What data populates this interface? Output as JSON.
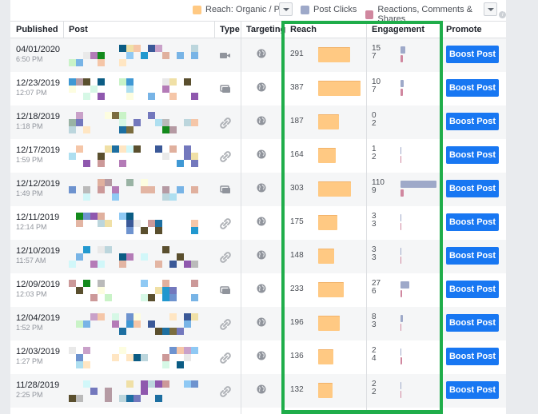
{
  "legend": {
    "items": [
      {
        "label": "Reach: Organic / Paid",
        "color": "#ffc983"
      },
      {
        "label": "Post Clicks",
        "color": "#9ea9c9"
      },
      {
        "label": "Reactions, Comments & Shares",
        "color": "#d0879f"
      }
    ],
    "info_icon": "info-icon"
  },
  "table": {
    "headers": [
      "Published",
      "Post",
      "Type",
      "Targeting",
      "Reach",
      "Engagement",
      "Promote"
    ],
    "reach_max": 387,
    "clicks_max": 110,
    "rows": [
      {
        "date": "04/01/2020",
        "time": "6:50 PM",
        "type": "video",
        "targeting": "public",
        "reach": 291,
        "clicks": 15,
        "reactions": 7,
        "button": "Boost Post"
      },
      {
        "date": "12/23/2019",
        "time": "12:07 PM",
        "type": "album",
        "targeting": "public",
        "reach": 387,
        "clicks": 10,
        "reactions": 7,
        "button": "Boost Post"
      },
      {
        "date": "12/18/2019",
        "time": "1:18 PM",
        "type": "link",
        "targeting": "public",
        "reach": 187,
        "clicks": 0,
        "reactions": 2,
        "button": "Boost Post"
      },
      {
        "date": "12/17/2019",
        "time": "1:59 PM",
        "type": "link",
        "targeting": "public",
        "reach": 164,
        "clicks": 1,
        "reactions": 2,
        "button": "Boost Post"
      },
      {
        "date": "12/12/2019",
        "time": "1:49 PM",
        "type": "album",
        "targeting": "public",
        "reach": 303,
        "clicks": 110,
        "reactions": 9,
        "button": "Boost Post"
      },
      {
        "date": "12/11/2019",
        "time": "12:14 PM",
        "type": "link",
        "targeting": "public",
        "reach": 175,
        "clicks": 3,
        "reactions": 3,
        "button": "Boost Post"
      },
      {
        "date": "12/10/2019",
        "time": "11:57 AM",
        "type": "link",
        "targeting": "public",
        "reach": 148,
        "clicks": 3,
        "reactions": 3,
        "button": "Boost Post"
      },
      {
        "date": "12/09/2019",
        "time": "12:03 PM",
        "type": "album",
        "targeting": "public",
        "reach": 233,
        "clicks": 27,
        "reactions": 6,
        "button": "Boost Post"
      },
      {
        "date": "12/04/2019",
        "time": "1:52 PM",
        "type": "link",
        "targeting": "public",
        "reach": 196,
        "clicks": 8,
        "reactions": 3,
        "button": "Boost Post"
      },
      {
        "date": "12/03/2019",
        "time": "1:27 PM",
        "type": "link",
        "targeting": "public",
        "reach": 136,
        "clicks": 2,
        "reactions": 4,
        "button": "Boost Post"
      },
      {
        "date": "11/28/2019",
        "time": "2:25 PM",
        "type": "link",
        "targeting": "public",
        "reach": 132,
        "clicks": 2,
        "reactions": 2,
        "button": "Boost Post"
      }
    ]
  },
  "highlight_color": "#1fad4a",
  "boost_color": "#1877f2"
}
